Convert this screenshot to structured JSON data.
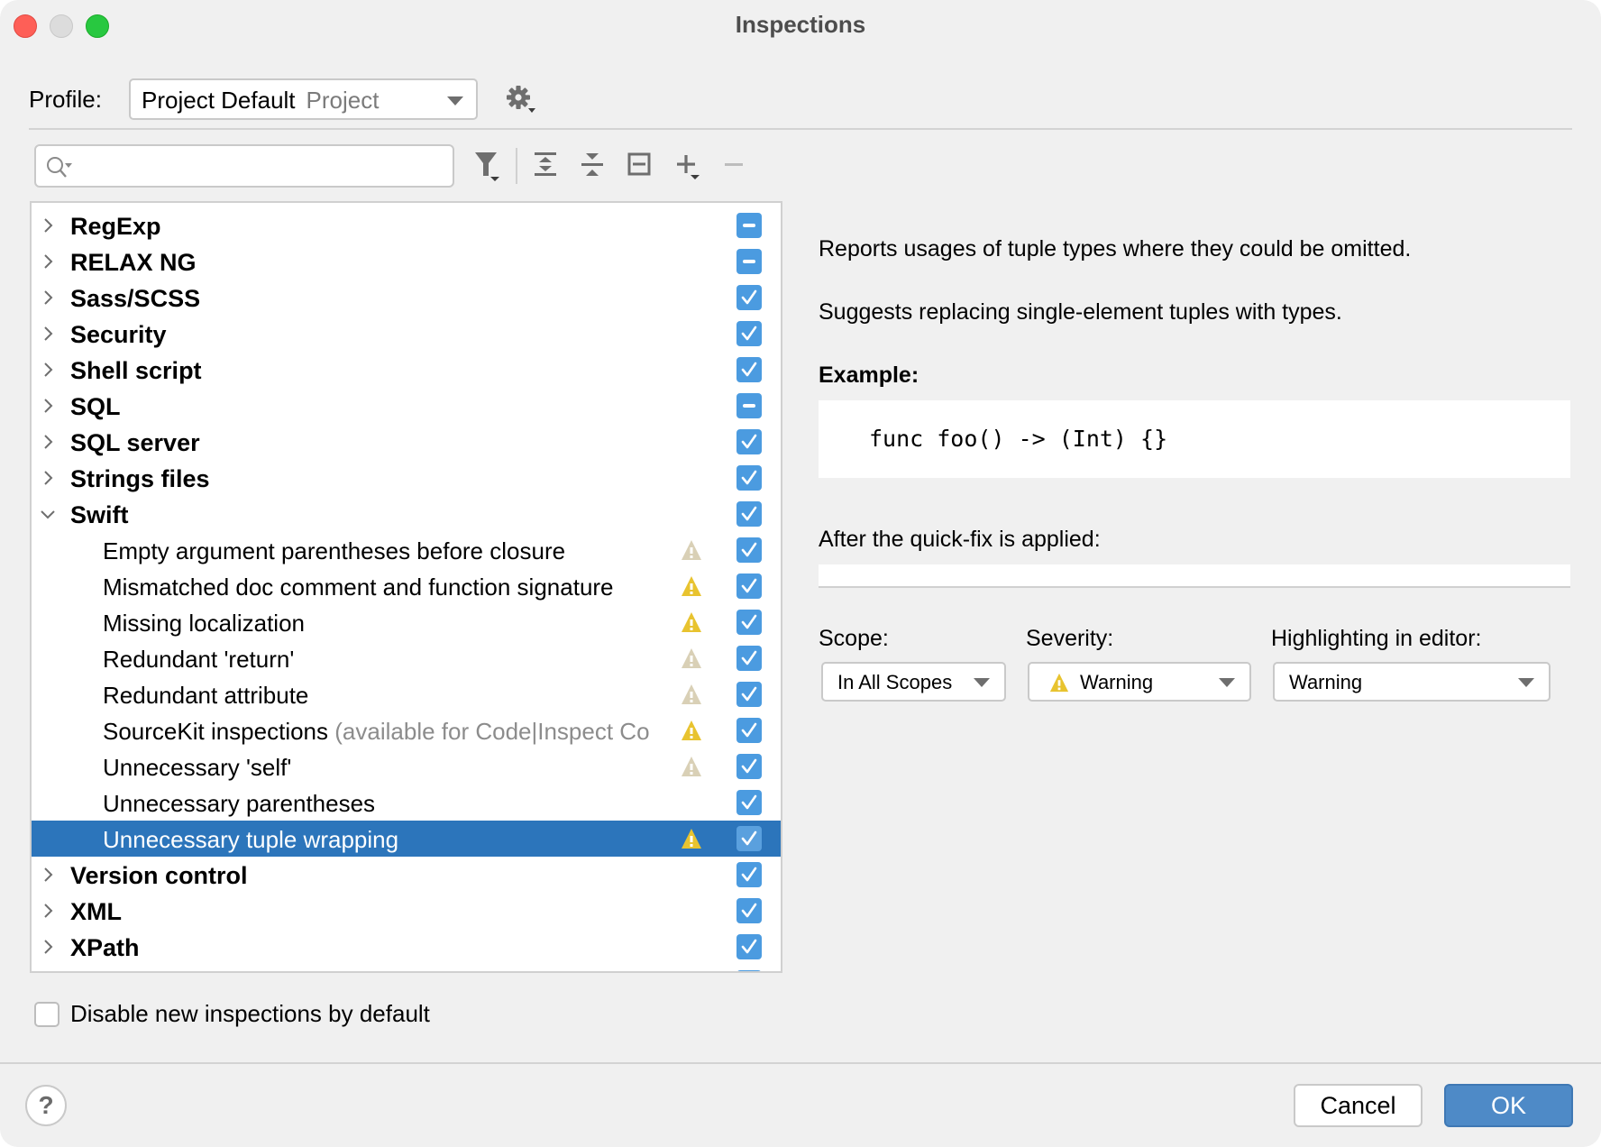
{
  "window": {
    "title": "Inspections"
  },
  "profile": {
    "label": "Profile:",
    "value": "Project Default",
    "scope": "Project"
  },
  "search": {
    "value": "",
    "placeholder": ""
  },
  "toolbar": {
    "icons": [
      "filter-icon",
      "expand-all-icon",
      "collapse-all-icon",
      "reset-to-empty-icon",
      "add-icon",
      "remove-icon"
    ]
  },
  "tree": {
    "rows": [
      {
        "label": "RegExp",
        "type": "group",
        "expanded": false,
        "checkbox": "partial"
      },
      {
        "label": "RELAX NG",
        "type": "group",
        "expanded": false,
        "checkbox": "partial"
      },
      {
        "label": "Sass/SCSS",
        "type": "group",
        "expanded": false,
        "checkbox": "checked"
      },
      {
        "label": "Security",
        "type": "group",
        "expanded": false,
        "checkbox": "checked"
      },
      {
        "label": "Shell script",
        "type": "group",
        "expanded": false,
        "checkbox": "checked"
      },
      {
        "label": "SQL",
        "type": "group",
        "expanded": false,
        "checkbox": "partial"
      },
      {
        "label": "SQL server",
        "type": "group",
        "expanded": false,
        "checkbox": "checked"
      },
      {
        "label": "Strings files",
        "type": "group",
        "expanded": false,
        "checkbox": "checked"
      },
      {
        "label": "Swift",
        "type": "group",
        "expanded": true,
        "checkbox": "checked"
      },
      {
        "label": "Empty argument parentheses before closure",
        "type": "leaf",
        "severity": "weak-warning",
        "checkbox": "checked"
      },
      {
        "label": "Mismatched doc comment and function signature",
        "type": "leaf",
        "severity": "warning",
        "checkbox": "checked"
      },
      {
        "label": "Missing localization",
        "type": "leaf",
        "severity": "warning",
        "checkbox": "checked"
      },
      {
        "label": "Redundant 'return'",
        "type": "leaf",
        "severity": "weak-warning",
        "checkbox": "checked"
      },
      {
        "label": "Redundant attribute",
        "type": "leaf",
        "severity": "weak-warning",
        "checkbox": "checked"
      },
      {
        "label": "SourceKit inspections",
        "hint": "(available for Code|Inspect Co",
        "type": "leaf",
        "severity": "warning",
        "checkbox": "checked"
      },
      {
        "label": "Unnecessary 'self'",
        "type": "leaf",
        "severity": "weak-warning",
        "checkbox": "checked"
      },
      {
        "label": "Unnecessary parentheses",
        "type": "leaf",
        "severity": "none",
        "checkbox": "checked"
      },
      {
        "label": "Unnecessary tuple wrapping",
        "type": "leaf",
        "severity": "warning",
        "checkbox": "checked",
        "selected": true
      },
      {
        "label": "Version control",
        "type": "group",
        "expanded": false,
        "checkbox": "checked"
      },
      {
        "label": "XML",
        "type": "group",
        "expanded": false,
        "checkbox": "checked"
      },
      {
        "label": "XPath",
        "type": "group",
        "expanded": false,
        "checkbox": "checked"
      }
    ]
  },
  "disable_new": {
    "label": "Disable new inspections by default",
    "checked": false
  },
  "details": {
    "description_1": "Reports usages of tuple types where they could be omitted.",
    "description_2": "Suggests replacing single-element tuples with types.",
    "example_title": "Example:",
    "example_code": "func foo() -> (Int) {}",
    "after_label": "After the quick-fix is applied:",
    "after_code": "",
    "scope_label": "Scope:",
    "scope_value": "In All Scopes",
    "severity_label": "Severity:",
    "severity_value": "Warning",
    "highlighting_label": "Highlighting in editor:",
    "highlighting_value": "Warning"
  },
  "footer": {
    "help": "?",
    "cancel": "Cancel",
    "ok": "OK"
  },
  "colors": {
    "accent": "#4e8ac7",
    "selection": "#2c75bb",
    "checkbox": "#4b9be0",
    "warning": "#e8c32f",
    "weak_warning": "#d9d0b6"
  }
}
